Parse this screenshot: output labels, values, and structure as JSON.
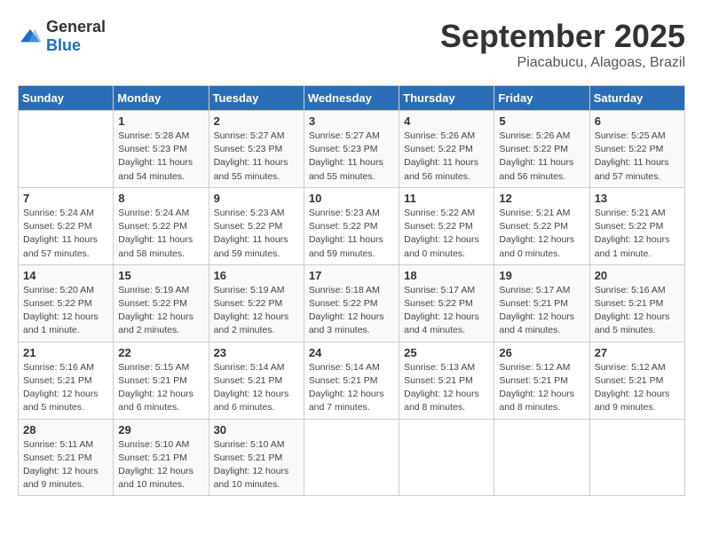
{
  "logo": {
    "text_general": "General",
    "text_blue": "Blue"
  },
  "title": "September 2025",
  "subtitle": "Piacabucu, Alagoas, Brazil",
  "days_of_week": [
    "Sunday",
    "Monday",
    "Tuesday",
    "Wednesday",
    "Thursday",
    "Friday",
    "Saturday"
  ],
  "weeks": [
    [
      {
        "day": "",
        "info": ""
      },
      {
        "day": "1",
        "info": "Sunrise: 5:28 AM\nSunset: 5:23 PM\nDaylight: 11 hours\nand 54 minutes."
      },
      {
        "day": "2",
        "info": "Sunrise: 5:27 AM\nSunset: 5:23 PM\nDaylight: 11 hours\nand 55 minutes."
      },
      {
        "day": "3",
        "info": "Sunrise: 5:27 AM\nSunset: 5:23 PM\nDaylight: 11 hours\nand 55 minutes."
      },
      {
        "day": "4",
        "info": "Sunrise: 5:26 AM\nSunset: 5:22 PM\nDaylight: 11 hours\nand 56 minutes."
      },
      {
        "day": "5",
        "info": "Sunrise: 5:26 AM\nSunset: 5:22 PM\nDaylight: 11 hours\nand 56 minutes."
      },
      {
        "day": "6",
        "info": "Sunrise: 5:25 AM\nSunset: 5:22 PM\nDaylight: 11 hours\nand 57 minutes."
      }
    ],
    [
      {
        "day": "7",
        "info": "Sunrise: 5:24 AM\nSunset: 5:22 PM\nDaylight: 11 hours\nand 57 minutes."
      },
      {
        "day": "8",
        "info": "Sunrise: 5:24 AM\nSunset: 5:22 PM\nDaylight: 11 hours\nand 58 minutes."
      },
      {
        "day": "9",
        "info": "Sunrise: 5:23 AM\nSunset: 5:22 PM\nDaylight: 11 hours\nand 59 minutes."
      },
      {
        "day": "10",
        "info": "Sunrise: 5:23 AM\nSunset: 5:22 PM\nDaylight: 11 hours\nand 59 minutes."
      },
      {
        "day": "11",
        "info": "Sunrise: 5:22 AM\nSunset: 5:22 PM\nDaylight: 12 hours\nand 0 minutes."
      },
      {
        "day": "12",
        "info": "Sunrise: 5:21 AM\nSunset: 5:22 PM\nDaylight: 12 hours\nand 0 minutes."
      },
      {
        "day": "13",
        "info": "Sunrise: 5:21 AM\nSunset: 5:22 PM\nDaylight: 12 hours\nand 1 minute."
      }
    ],
    [
      {
        "day": "14",
        "info": "Sunrise: 5:20 AM\nSunset: 5:22 PM\nDaylight: 12 hours\nand 1 minute."
      },
      {
        "day": "15",
        "info": "Sunrise: 5:19 AM\nSunset: 5:22 PM\nDaylight: 12 hours\nand 2 minutes."
      },
      {
        "day": "16",
        "info": "Sunrise: 5:19 AM\nSunset: 5:22 PM\nDaylight: 12 hours\nand 2 minutes."
      },
      {
        "day": "17",
        "info": "Sunrise: 5:18 AM\nSunset: 5:22 PM\nDaylight: 12 hours\nand 3 minutes."
      },
      {
        "day": "18",
        "info": "Sunrise: 5:17 AM\nSunset: 5:22 PM\nDaylight: 12 hours\nand 4 minutes."
      },
      {
        "day": "19",
        "info": "Sunrise: 5:17 AM\nSunset: 5:21 PM\nDaylight: 12 hours\nand 4 minutes."
      },
      {
        "day": "20",
        "info": "Sunrise: 5:16 AM\nSunset: 5:21 PM\nDaylight: 12 hours\nand 5 minutes."
      }
    ],
    [
      {
        "day": "21",
        "info": "Sunrise: 5:16 AM\nSunset: 5:21 PM\nDaylight: 12 hours\nand 5 minutes."
      },
      {
        "day": "22",
        "info": "Sunrise: 5:15 AM\nSunset: 5:21 PM\nDaylight: 12 hours\nand 6 minutes."
      },
      {
        "day": "23",
        "info": "Sunrise: 5:14 AM\nSunset: 5:21 PM\nDaylight: 12 hours\nand 6 minutes."
      },
      {
        "day": "24",
        "info": "Sunrise: 5:14 AM\nSunset: 5:21 PM\nDaylight: 12 hours\nand 7 minutes."
      },
      {
        "day": "25",
        "info": "Sunrise: 5:13 AM\nSunset: 5:21 PM\nDaylight: 12 hours\nand 8 minutes."
      },
      {
        "day": "26",
        "info": "Sunrise: 5:12 AM\nSunset: 5:21 PM\nDaylight: 12 hours\nand 8 minutes."
      },
      {
        "day": "27",
        "info": "Sunrise: 5:12 AM\nSunset: 5:21 PM\nDaylight: 12 hours\nand 9 minutes."
      }
    ],
    [
      {
        "day": "28",
        "info": "Sunrise: 5:11 AM\nSunset: 5:21 PM\nDaylight: 12 hours\nand 9 minutes."
      },
      {
        "day": "29",
        "info": "Sunrise: 5:10 AM\nSunset: 5:21 PM\nDaylight: 12 hours\nand 10 minutes."
      },
      {
        "day": "30",
        "info": "Sunrise: 5:10 AM\nSunset: 5:21 PM\nDaylight: 12 hours\nand 10 minutes."
      },
      {
        "day": "",
        "info": ""
      },
      {
        "day": "",
        "info": ""
      },
      {
        "day": "",
        "info": ""
      },
      {
        "day": "",
        "info": ""
      }
    ]
  ]
}
